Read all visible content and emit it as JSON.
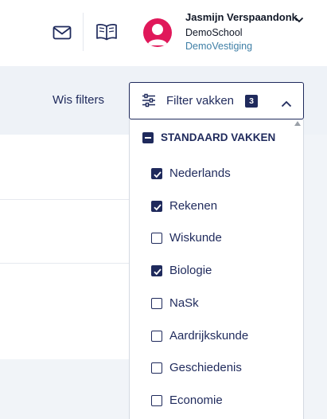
{
  "header": {
    "icons": [
      "mail-icon",
      "book-icon"
    ],
    "user": {
      "name": "Jasmijn Verspaandonk",
      "school": "DemoSchool",
      "location": "DemoVestiging"
    }
  },
  "filters": {
    "clear_label": "Wis filters",
    "button_label": "Filter vakken",
    "count": "3"
  },
  "dropdown": {
    "group_label": "STANDAARD VAKKEN",
    "items": [
      {
        "label": "Nederlands",
        "checked": true
      },
      {
        "label": "Rekenen",
        "checked": true
      },
      {
        "label": "Wiskunde",
        "checked": false
      },
      {
        "label": "Biologie",
        "checked": true
      },
      {
        "label": "NaSk",
        "checked": false
      },
      {
        "label": "Aardrijkskunde",
        "checked": false
      },
      {
        "label": "Geschiedenis",
        "checked": false
      },
      {
        "label": "Economie",
        "checked": false
      }
    ]
  },
  "colors": {
    "primary": "#1f2a5c",
    "avatar": "#e0185a",
    "location_text": "#3f7fa6",
    "background": "#f1f4f8"
  }
}
